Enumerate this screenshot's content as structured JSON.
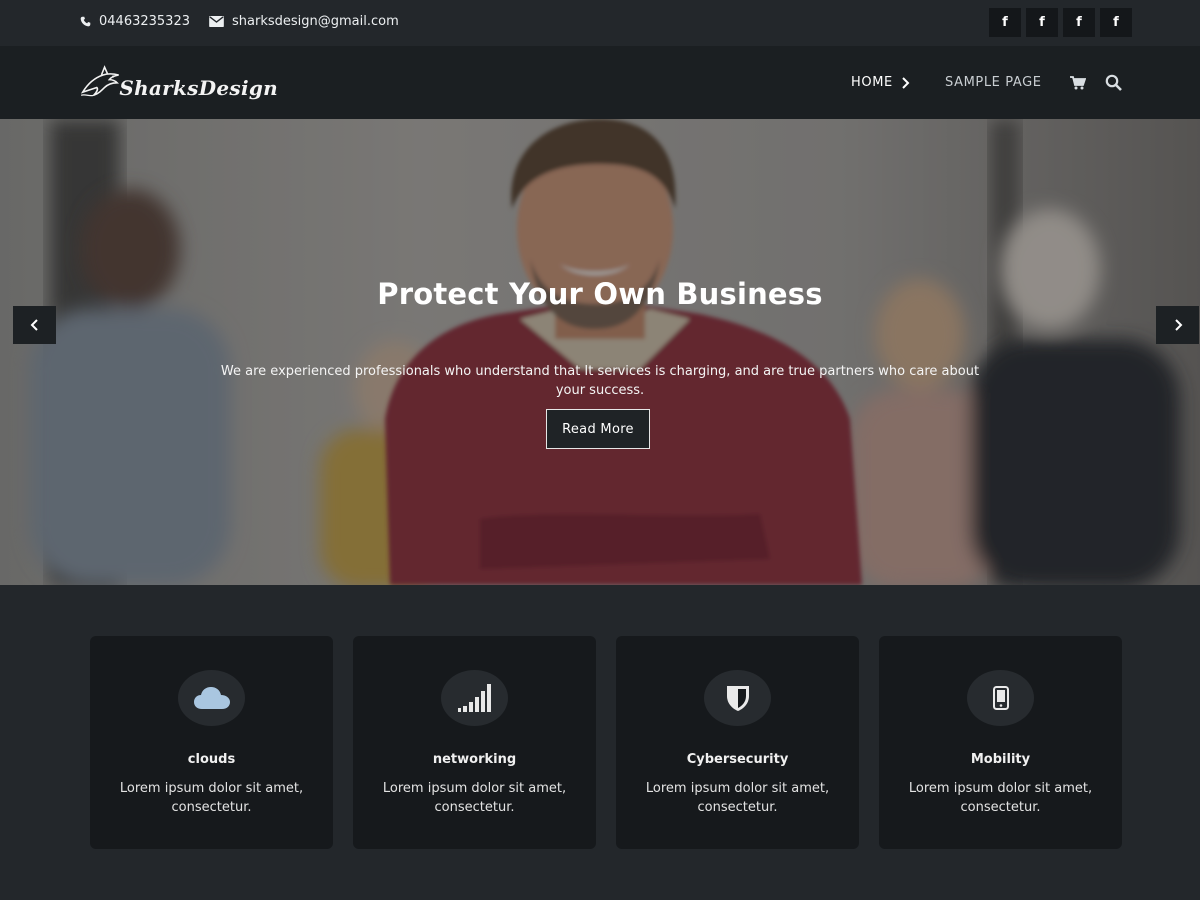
{
  "topbar": {
    "phone": "04463235323",
    "email": "sharksdesign@gmail.com",
    "socials": [
      "f",
      "f",
      "f",
      "f"
    ]
  },
  "header": {
    "logo_text": "SharksDesign",
    "nav": {
      "home": "HOME",
      "sample": "SAMPLE PAGE"
    }
  },
  "hero": {
    "title": "Protect Your Own Business",
    "text": "We are experienced professionals who understand that It services is charging, and are true partners who care about your success.",
    "button": "Read More"
  },
  "features": [
    {
      "icon": "cloud-icon",
      "title": "clouds",
      "text": "Lorem ipsum dolor sit amet, consectetur."
    },
    {
      "icon": "signal-icon",
      "title": "networking",
      "text": "Lorem ipsum dolor sit amet, consectetur."
    },
    {
      "icon": "shield-icon",
      "title": "Cybersecurity",
      "text": "Lorem ipsum dolor sit amet, consectetur."
    },
    {
      "icon": "mobile-icon",
      "title": "Mobility",
      "text": "Lorem ipsum dolor sit amet, consectetur."
    }
  ],
  "colors": {
    "background": "#23272b",
    "header": "#1b1f22",
    "card": "#16191c",
    "accent_text": "#ffffff"
  }
}
